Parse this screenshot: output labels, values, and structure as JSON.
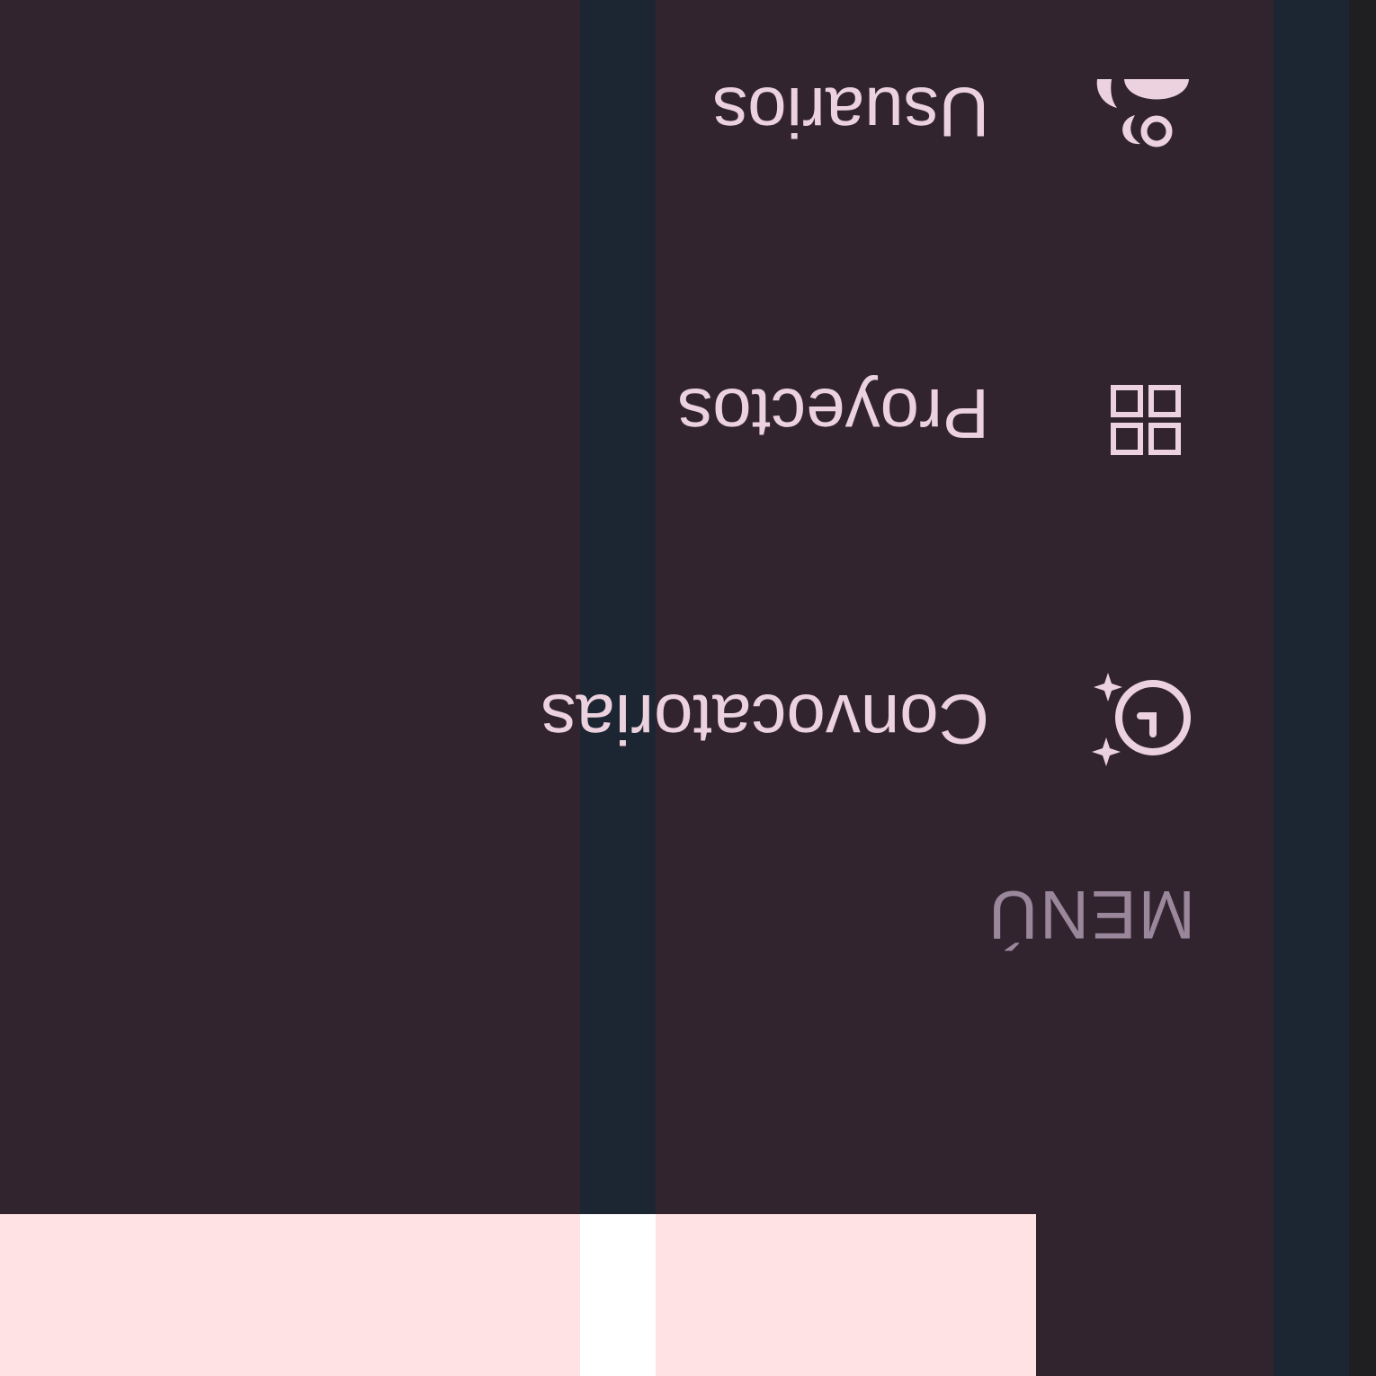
{
  "sidebar": {
    "section_label": "MENÚ",
    "items": [
      {
        "label": "Convocatorias",
        "icon": "clock-sparkle-icon"
      },
      {
        "label": "Proyectos",
        "icon": "grid-icon"
      },
      {
        "label": "Usuarios",
        "icon": "users-icon"
      }
    ]
  },
  "colors": {
    "background": "#31242f",
    "stripe": "#1c2632",
    "text": "#ecd2df",
    "muted_text": "#9b879b",
    "light_block": "#ffe2e4"
  }
}
